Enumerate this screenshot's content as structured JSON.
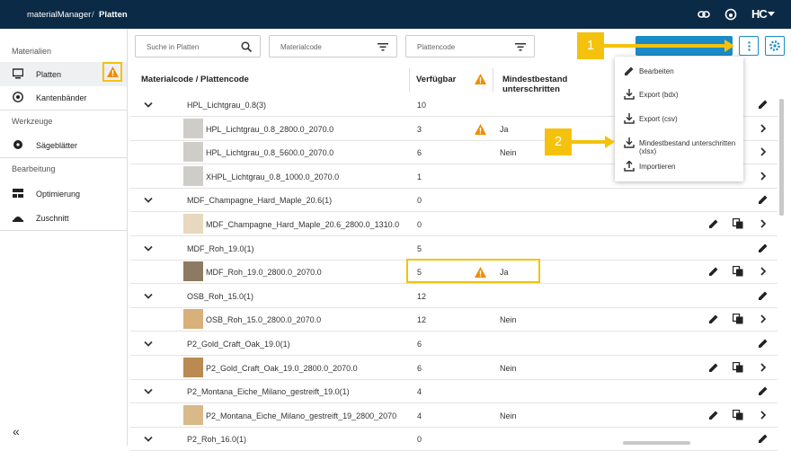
{
  "topbar": {
    "app": "materialManager",
    "separator": "/",
    "page": "Platten",
    "brand": "HC"
  },
  "sidebar": {
    "sections": [
      {
        "title": "Materialien",
        "items": [
          {
            "label": "Platten"
          },
          {
            "label": "Kantenbänder"
          }
        ]
      },
      {
        "title": "Werkzeuge",
        "items": [
          {
            "label": "Sägeblätter"
          }
        ]
      },
      {
        "title": "Bearbeitung",
        "items": [
          {
            "label": "Optimierung"
          },
          {
            "label": "Zuschnitt"
          }
        ]
      }
    ],
    "collapse": "«"
  },
  "filters": {
    "search_placeholder": "Suche in Platten",
    "materialcode": "Materialcode",
    "plattencode": "Plattencode"
  },
  "table": {
    "headers": {
      "code": "Materialcode / Plattencode",
      "available": "Verfügbar",
      "min_stock": "Mindestbestand unterschritten"
    },
    "rows": [
      {
        "type": "group",
        "code": "HPL_Lichtgrau_0.8(3)",
        "available": "10"
      },
      {
        "type": "item",
        "code": "HPL_Lichtgrau_0.8_2800.0_2070.0",
        "available": "3",
        "warn": true,
        "min": "Ja",
        "thumb": "#cfcdc8"
      },
      {
        "type": "item",
        "code": "HPL_Lichtgrau_0.8_5600.0_2070.0",
        "available": "6",
        "warn": false,
        "min": "Nein",
        "thumb": "#cfcdc8"
      },
      {
        "type": "item",
        "code": "XHPL_Lichtgrau_0.8_1000.0_2070.0",
        "available": "1",
        "warn": false,
        "min": "",
        "thumb": "#cfcdc8"
      },
      {
        "type": "group",
        "code": "MDF_Champagne_Hard_Maple_20.6(1)",
        "available": "0"
      },
      {
        "type": "item",
        "code": "MDF_Champagne_Hard_Maple_20.6_2800.0_1310.0",
        "available": "0",
        "warn": false,
        "min": "",
        "thumb": "#e8d8bf"
      },
      {
        "type": "group",
        "code": "MDF_Roh_19.0(1)",
        "available": "5"
      },
      {
        "type": "item",
        "code": "MDF_Roh_19.0_2800.0_2070.0",
        "available": "5",
        "warn": true,
        "min": "Ja",
        "thumb": "#8d7a62"
      },
      {
        "type": "group",
        "code": "OSB_Roh_15.0(1)",
        "available": "12"
      },
      {
        "type": "item",
        "code": "OSB_Roh_15.0_2800.0_2070.0",
        "available": "12",
        "warn": false,
        "min": "Nein",
        "thumb": "#d7b07a"
      },
      {
        "type": "group",
        "code": "P2_Gold_Craft_Oak_19.0(1)",
        "available": "6"
      },
      {
        "type": "item",
        "code": "P2_Gold_Craft_Oak_19.0_2800.0_2070.0",
        "available": "6",
        "warn": false,
        "min": "Nein",
        "thumb": "#b98a52"
      },
      {
        "type": "group",
        "code": "P2_Montana_Eiche_Milano_gestreift_19.0(1)",
        "available": "4"
      },
      {
        "type": "item",
        "code": "P2_Montana_Eiche_Milano_gestreift_19_2800_2070",
        "available": "4",
        "warn": false,
        "min": "Nein",
        "thumb": "#d9b88a"
      },
      {
        "type": "group",
        "code": "P2_Roh_16.0(1)",
        "available": "0"
      }
    ]
  },
  "menu": {
    "items": [
      {
        "label": "Bearbeiten",
        "icon": "pencil-icon"
      },
      {
        "label": "Export (bdx)",
        "icon": "download-icon"
      },
      {
        "label": "Export (csv)",
        "icon": "download-icon"
      },
      {
        "label": "Mindestbestand unterschritten (xlsx)",
        "icon": "download-icon"
      },
      {
        "label": "Importieren",
        "icon": "upload-icon"
      }
    ]
  },
  "callouts": {
    "one": "1",
    "two": "2"
  },
  "colors": {
    "topbar": "#0b2a45",
    "accent": "#1a8bc6",
    "warning": "#f08c00",
    "callout": "#f4c20d"
  }
}
